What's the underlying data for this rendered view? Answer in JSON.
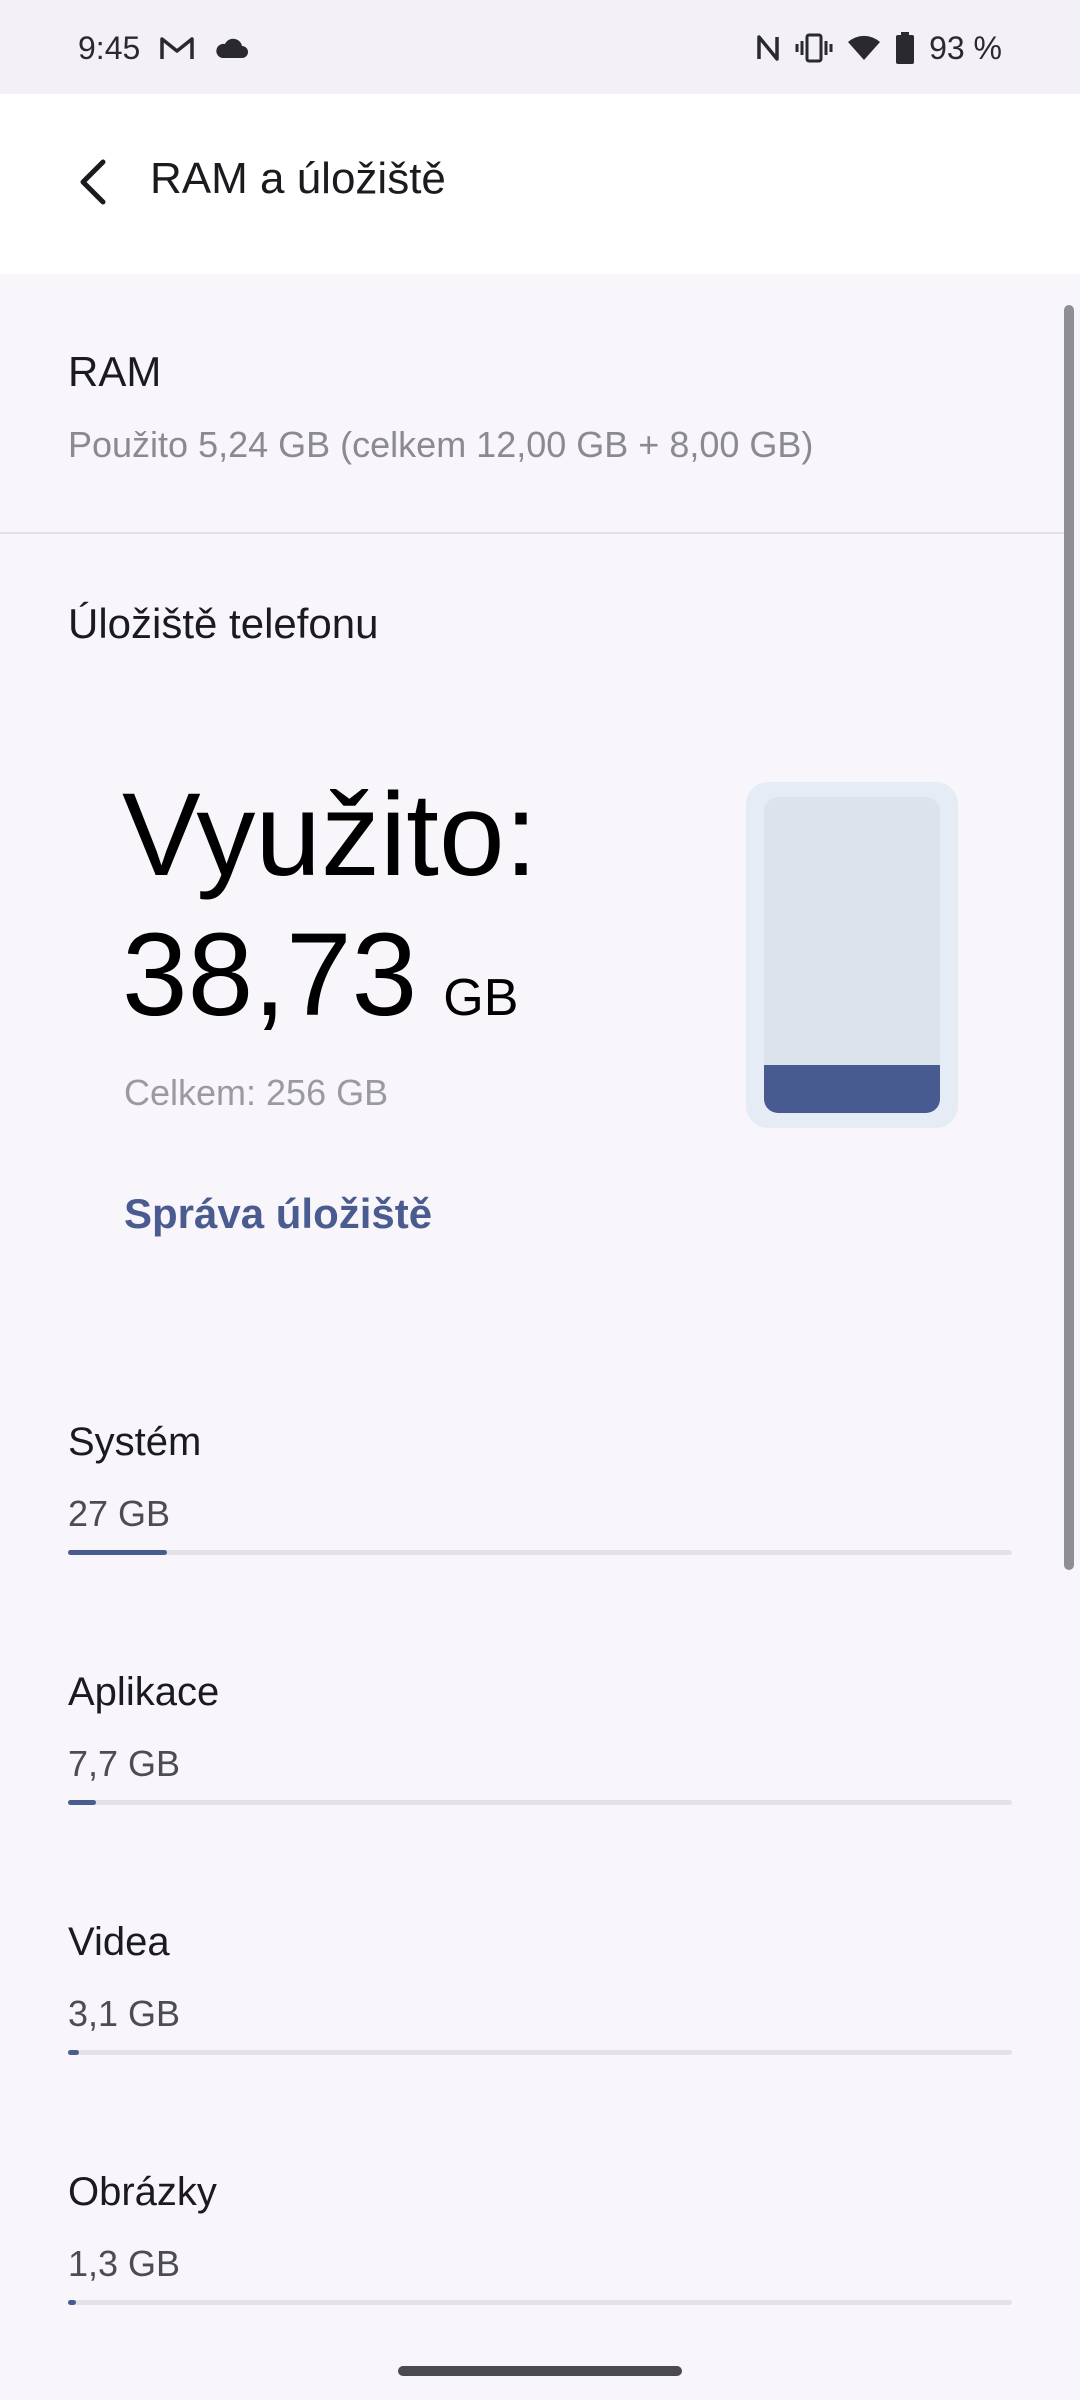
{
  "status_bar": {
    "time": "9:45",
    "left_icons": [
      "gmail-icon",
      "cloud-icon"
    ],
    "right_icons": [
      "nfc-icon",
      "vibrate-icon",
      "wifi-icon",
      "battery-icon"
    ],
    "battery": "93 %"
  },
  "header": {
    "title": "RAM a úložiště",
    "back_icon": "back-arrow-icon"
  },
  "ram": {
    "title": "RAM",
    "summary": "Použito 5,24 GB (celkem 12,00 GB + 8,00 GB)"
  },
  "storage": {
    "section_title": "Úložiště telefonu",
    "used_label": "Využito:",
    "used_value": "38,73",
    "used_unit": "GB",
    "total": "Celkem: 256 GB",
    "manage_link": "Správa úložiště",
    "used_fraction": 0.151
  },
  "categories": [
    {
      "name": "Systém",
      "size": "27 GB",
      "fraction": 0.105
    },
    {
      "name": "Aplikace",
      "size": "7,7 GB",
      "fraction": 0.03
    },
    {
      "name": "Videa",
      "size": "3,1 GB",
      "fraction": 0.012
    },
    {
      "name": "Obrázky",
      "size": "1,3 GB",
      "fraction": 0.005
    }
  ],
  "colors": {
    "accent": "#4a5c8f",
    "phone_fill": "#485b91"
  }
}
